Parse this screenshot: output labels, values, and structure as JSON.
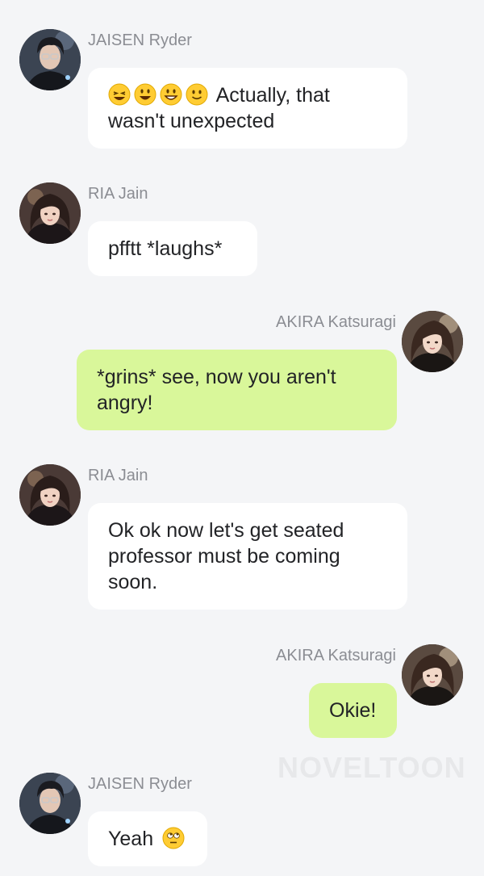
{
  "watermark": "NOVELTOON",
  "messages": [
    {
      "sender": "JAISEN Ryder",
      "side": "left",
      "avatar": "male-avatar-glasses",
      "emojis": [
        "grinning-squint-face",
        "smiling-face-open-mouth",
        "grinning-face",
        "slightly-smiling-face"
      ],
      "text": "Actually, that wasn't unexpected"
    },
    {
      "sender": "RIA Jain",
      "side": "left",
      "avatar": "female-avatar-ria",
      "text": "pfftt *laughs*"
    },
    {
      "sender": "AKIRA Katsuragi",
      "side": "right",
      "avatar": "female-avatar-akira",
      "text": "*grins* see, now you aren't angry!"
    },
    {
      "sender": "RIA Jain",
      "side": "left",
      "avatar": "female-avatar-ria",
      "text": "Ok ok now let's get seated professor must be coming soon."
    },
    {
      "sender": "AKIRA Katsuragi",
      "side": "right",
      "avatar": "female-avatar-akira",
      "text": "Okie!"
    },
    {
      "sender": "JAISEN Ryder",
      "side": "left",
      "avatar": "male-avatar-glasses",
      "text": "Yeah",
      "trailing_emoji": "face-with-rolling-eyes"
    }
  ]
}
